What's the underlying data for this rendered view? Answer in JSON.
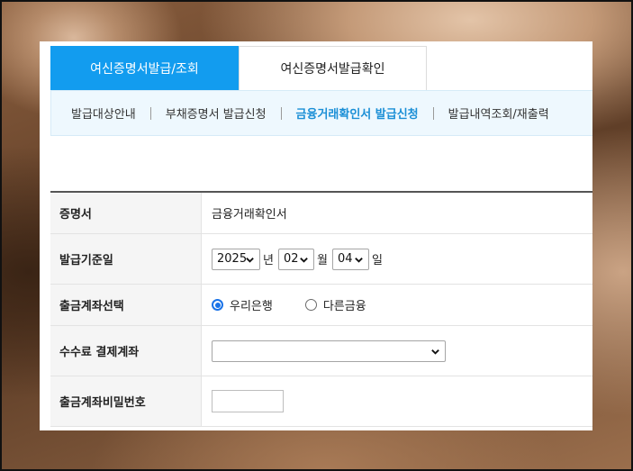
{
  "tabs": [
    {
      "label": "여신증명서발급/조회",
      "active": true
    },
    {
      "label": "여신증명서발급확인",
      "active": false
    }
  ],
  "subnav": [
    {
      "label": "발급대상안내",
      "current": false
    },
    {
      "label": "부채증명서 발급신청",
      "current": false
    },
    {
      "label": "금융거래확인서 발급신청",
      "current": true
    },
    {
      "label": "발급내역조회/재출력",
      "current": false
    }
  ],
  "form": {
    "certificate": {
      "label": "증명서",
      "value": "금융거래확인서"
    },
    "issue_date": {
      "label": "발급기준일",
      "year": "2025",
      "year_unit": "년",
      "month": "02",
      "month_unit": "월",
      "day": "04",
      "day_unit": "일"
    },
    "account_select": {
      "label": "출금계좌선택",
      "options": [
        "우리은행",
        "다른금융"
      ],
      "selected": "우리은행"
    },
    "fee_account": {
      "label": "수수료 결제계좌",
      "value": ""
    },
    "password": {
      "label": "출금계좌비밀번호",
      "value": ""
    }
  },
  "colors": {
    "active_tab": "#129cef",
    "current_subnav": "#1b8fd6",
    "radio_on": "#1a73e8"
  }
}
